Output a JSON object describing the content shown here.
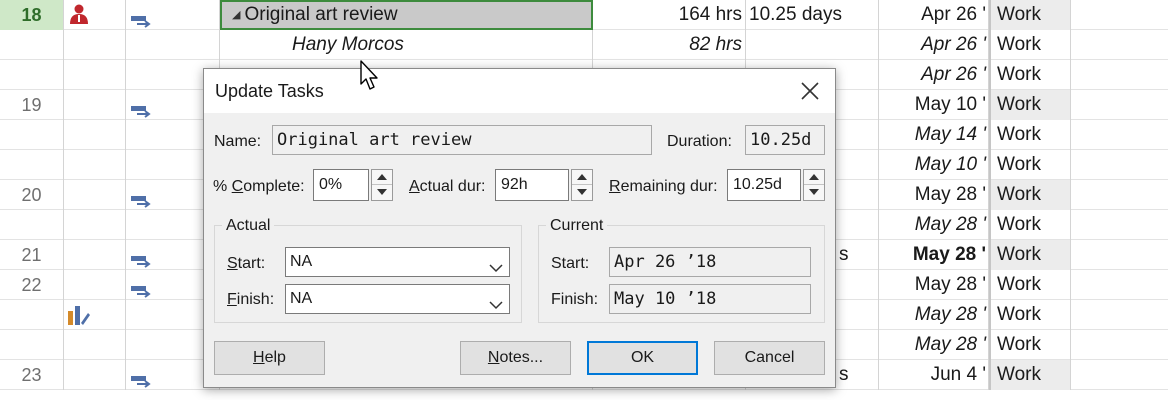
{
  "grid": {
    "rows": [
      {
        "id": "18",
        "name": "Original art review",
        "work": "164 hrs",
        "duration": "10.25 days",
        "start": "Apr 26 '",
        "type": "Work",
        "selected": true,
        "has_resource_icon": true,
        "has_mode_icon": true,
        "summary": true
      },
      {
        "id": "",
        "name": "Hany Morcos",
        "work": "82 hrs",
        "duration": "",
        "start": "Apr 26 '",
        "type": "Work",
        "italic": true
      },
      {
        "id": "",
        "name": "",
        "work": "",
        "duration": "",
        "start": "Apr 26 '",
        "type": "Work",
        "italic": true
      },
      {
        "id": "19",
        "name": "",
        "work": "",
        "duration": "",
        "start": "May 10 '",
        "type": "Work",
        "has_mode_icon": true,
        "shaded_type": true
      },
      {
        "id": "",
        "name": "",
        "work": "",
        "duration": "",
        "start": "May 14 '",
        "type": "Work",
        "italic": true
      },
      {
        "id": "",
        "name": "",
        "work": "",
        "duration": "",
        "start": "May 10 '",
        "type": "Work",
        "italic": true
      },
      {
        "id": "20",
        "name": "",
        "work": "",
        "duration": "",
        "start": "May 28 '",
        "type": "Work",
        "has_mode_icon": true,
        "shaded_type": true
      },
      {
        "id": "",
        "name": "",
        "work": "",
        "duration": "",
        "start": "May 28 '",
        "type": "Work",
        "italic": true
      },
      {
        "id": "21",
        "name": "",
        "work": "",
        "duration": "s",
        "start": "May 28 '",
        "type": "Work",
        "has_mode_icon": true,
        "bold_start": true,
        "shaded_type": true
      },
      {
        "id": "22",
        "name": "",
        "work": "",
        "duration": "",
        "start": "May 28 '",
        "type": "Work",
        "has_mode_icon": true
      },
      {
        "id": "",
        "name": "",
        "work": "",
        "duration": "",
        "start": "May 28 '",
        "type": "Work",
        "italic": true,
        "has_chart_icon": true
      },
      {
        "id": "",
        "name": "",
        "work": "",
        "duration": "",
        "start": "May 28 '",
        "type": "Work",
        "italic": true
      },
      {
        "id": "23",
        "name": "",
        "work": "",
        "duration": "s",
        "start": "Jun 4 '",
        "type": "Work",
        "has_mode_icon": true,
        "shaded_type": true
      }
    ]
  },
  "dialog": {
    "title": "Update Tasks",
    "name_label": "Name:",
    "name_value": "Original art review",
    "duration_label": "Duration:",
    "duration_value": "10.25d",
    "pct_label_u": "C",
    "pct_label_pre": "% ",
    "pct_label_post": "omplete:",
    "pct_value": "0%",
    "actual_dur_label_u": "A",
    "actual_dur_label_post": "ctual dur:",
    "actual_dur_value": "92h",
    "remaining_label_u": "R",
    "remaining_label_post": "emaining dur:",
    "remaining_value": "10.25d",
    "actual_group": "Actual",
    "actual_start_label_u": "S",
    "actual_start_label_post": "tart:",
    "actual_start_value": "NA",
    "actual_finish_label_u": "F",
    "actual_finish_label_post": "inish:",
    "actual_finish_value": "NA",
    "current_group": "Current",
    "current_start_label": "Start:",
    "current_start_value": "Apr 26 ’18",
    "current_finish_label": "Finish:",
    "current_finish_value": "May 10 ’18",
    "help_u": "H",
    "help_post": "elp",
    "notes_u": "N",
    "notes_post": "otes...",
    "ok_label": "OK",
    "cancel_label": "Cancel"
  },
  "colors": {
    "selected_id_bg": "#cfe8c8",
    "selected_name_border": "#3d8b3d",
    "mode_icon": "#4f6fa8",
    "resource_icon": "#c0272d",
    "default_button_border": "#0078d7"
  },
  "icons": {
    "resource": "resource-person-icon",
    "task_mode": "auto-scheduled-task-icon",
    "chart": "bar-chart-edit-icon",
    "close": "close-icon",
    "dropdown": "chevron-down-icon",
    "cursor": "mouse-pointer-icon"
  }
}
